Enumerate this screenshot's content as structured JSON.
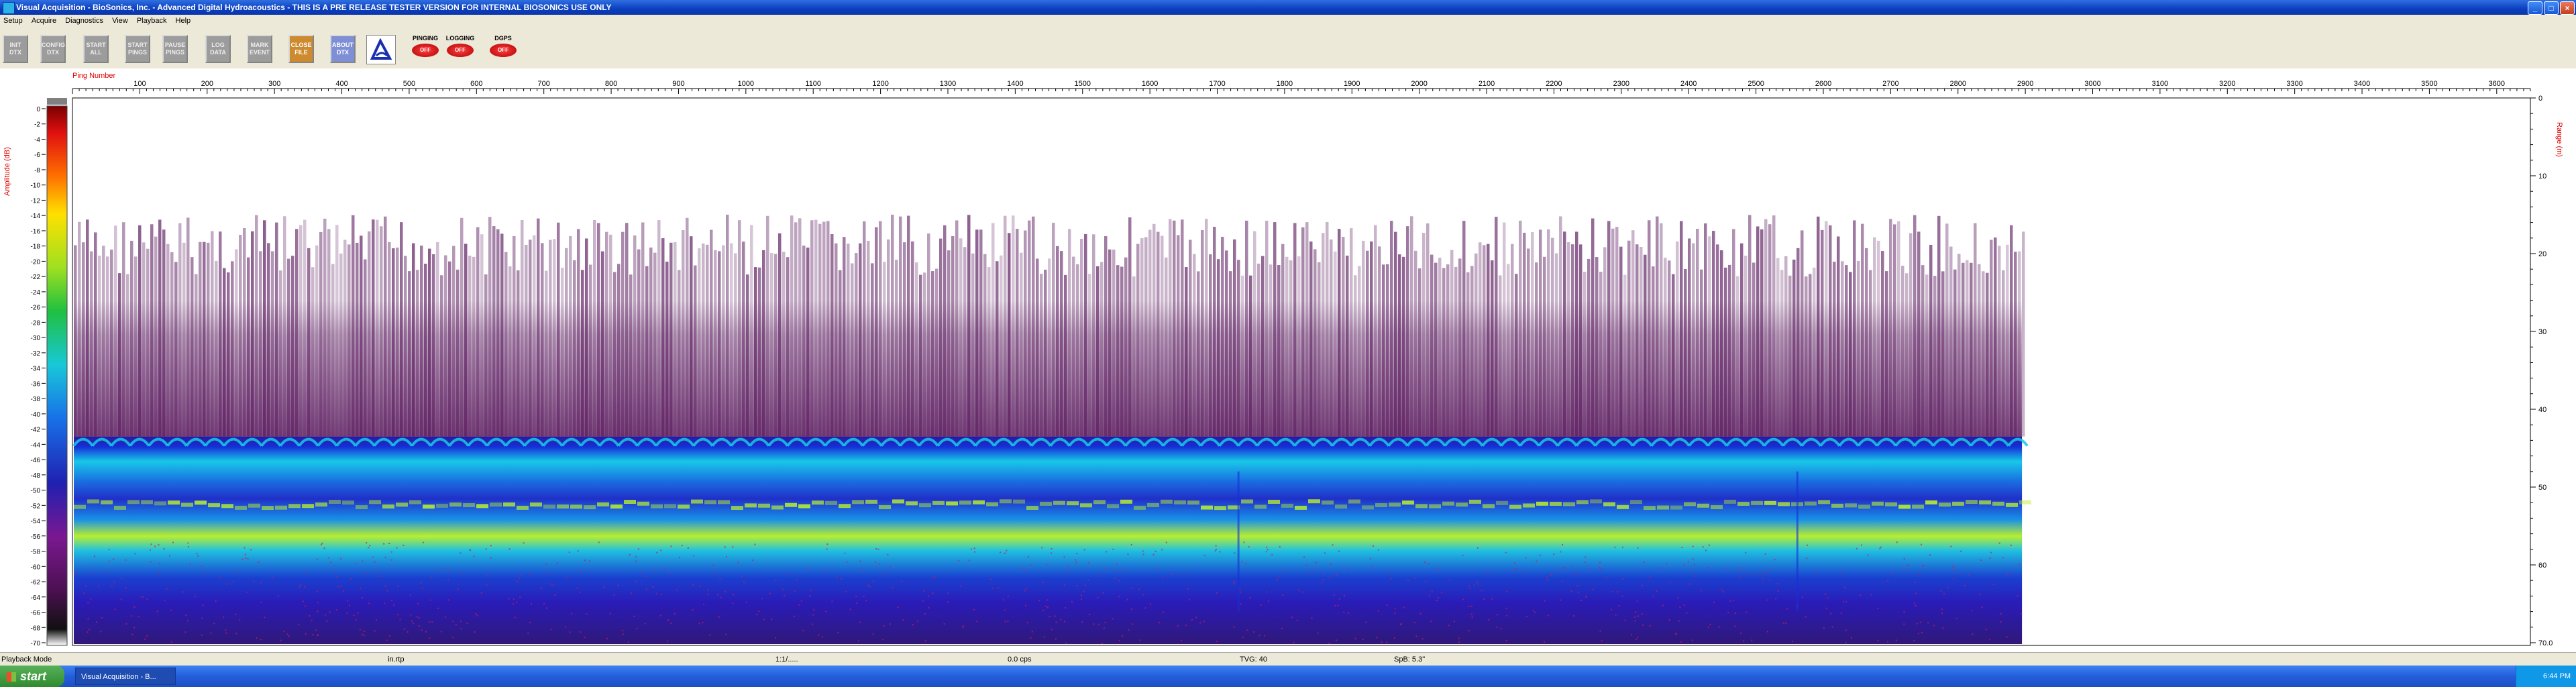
{
  "window": {
    "title": "Visual Acquisition  -  BioSonics, Inc.  -  Advanced Digital Hydroacoustics  -  THIS IS A PRE RELEASE TESTER VERSION FOR INTERNAL BIOSONICS USE ONLY",
    "minimize_label": "_",
    "maximize_label": "□",
    "close_label": "×"
  },
  "menu": [
    "Setup",
    "Acquire",
    "Diagnostics",
    "View",
    "Playback",
    "Help"
  ],
  "toolbar": {
    "buttons": [
      {
        "line1": "INIT",
        "line2": "DTX"
      },
      {
        "line1": "CONFIG",
        "line2": "DTX"
      },
      {
        "line1": "START",
        "line2": "ALL"
      },
      {
        "line1": "START",
        "line2": "PINGS"
      },
      {
        "line1": "PAUSE",
        "line2": "PINGS"
      },
      {
        "line1": "LOG",
        "line2": "DATA"
      },
      {
        "line1": "MARK",
        "line2": "EVENT"
      },
      {
        "line1": "CLOSE",
        "line2": "FILE"
      },
      {
        "line1": "ABOUT",
        "line2": "DTX"
      }
    ],
    "indicators": [
      {
        "label": "PINGING",
        "state": "OFF"
      },
      {
        "label": "LOGGING",
        "state": "OFF"
      },
      {
        "label": "DGPS",
        "state": "OFF"
      }
    ]
  },
  "echogram": {
    "x_axis_label": "Ping Number",
    "x_ticks": [
      100,
      200,
      300,
      400,
      500,
      600,
      700,
      800,
      900,
      1000,
      1100,
      1200,
      1300,
      1400,
      1500,
      1600,
      1700,
      1800,
      1900,
      2000,
      2100,
      2200,
      2300,
      2400,
      2500,
      2600,
      2700,
      2800,
      2900,
      3000,
      3100,
      3200,
      3300,
      3400,
      3500,
      3600
    ],
    "x_max": 3650,
    "data_end_ping": 2895,
    "amplitude_label": "Amplitude (dB)",
    "amplitude_ticks": [
      0,
      -2,
      -4,
      -6,
      -8,
      -10,
      -12,
      -14,
      -16,
      -18,
      -20,
      -22,
      -24,
      -26,
      -28,
      -30,
      -32,
      -34,
      -36,
      -38,
      -40,
      -42,
      -44,
      -46,
      -48,
      -50,
      -52,
      -54,
      -56,
      -58,
      -60,
      -62,
      -64,
      -66,
      -68,
      -70
    ],
    "range_label": "Range (m)",
    "range_ticks": [
      0,
      10,
      20,
      30,
      40,
      50,
      60,
      70
    ],
    "range_last_label": "70.0",
    "colors": {
      "noise": "#5a1a5e",
      "bottom_top": "#1530d8",
      "bottom_band": "#18c8e8",
      "bottom_core": "#b8ee30",
      "deep": "#2a1cb8",
      "speckle": "#c02060"
    }
  },
  "status_bar": {
    "mode": "Playback Mode",
    "file": "in.rtp",
    "time": "1:1/.....",
    "rate": "0.0 cps",
    "tvg": "TVG: 40",
    "spb": "SpB: 5.3\""
  },
  "taskbar": {
    "start_label": "start",
    "task_label": "Visual Acquisition - B...",
    "clock": "6:44 PM"
  }
}
